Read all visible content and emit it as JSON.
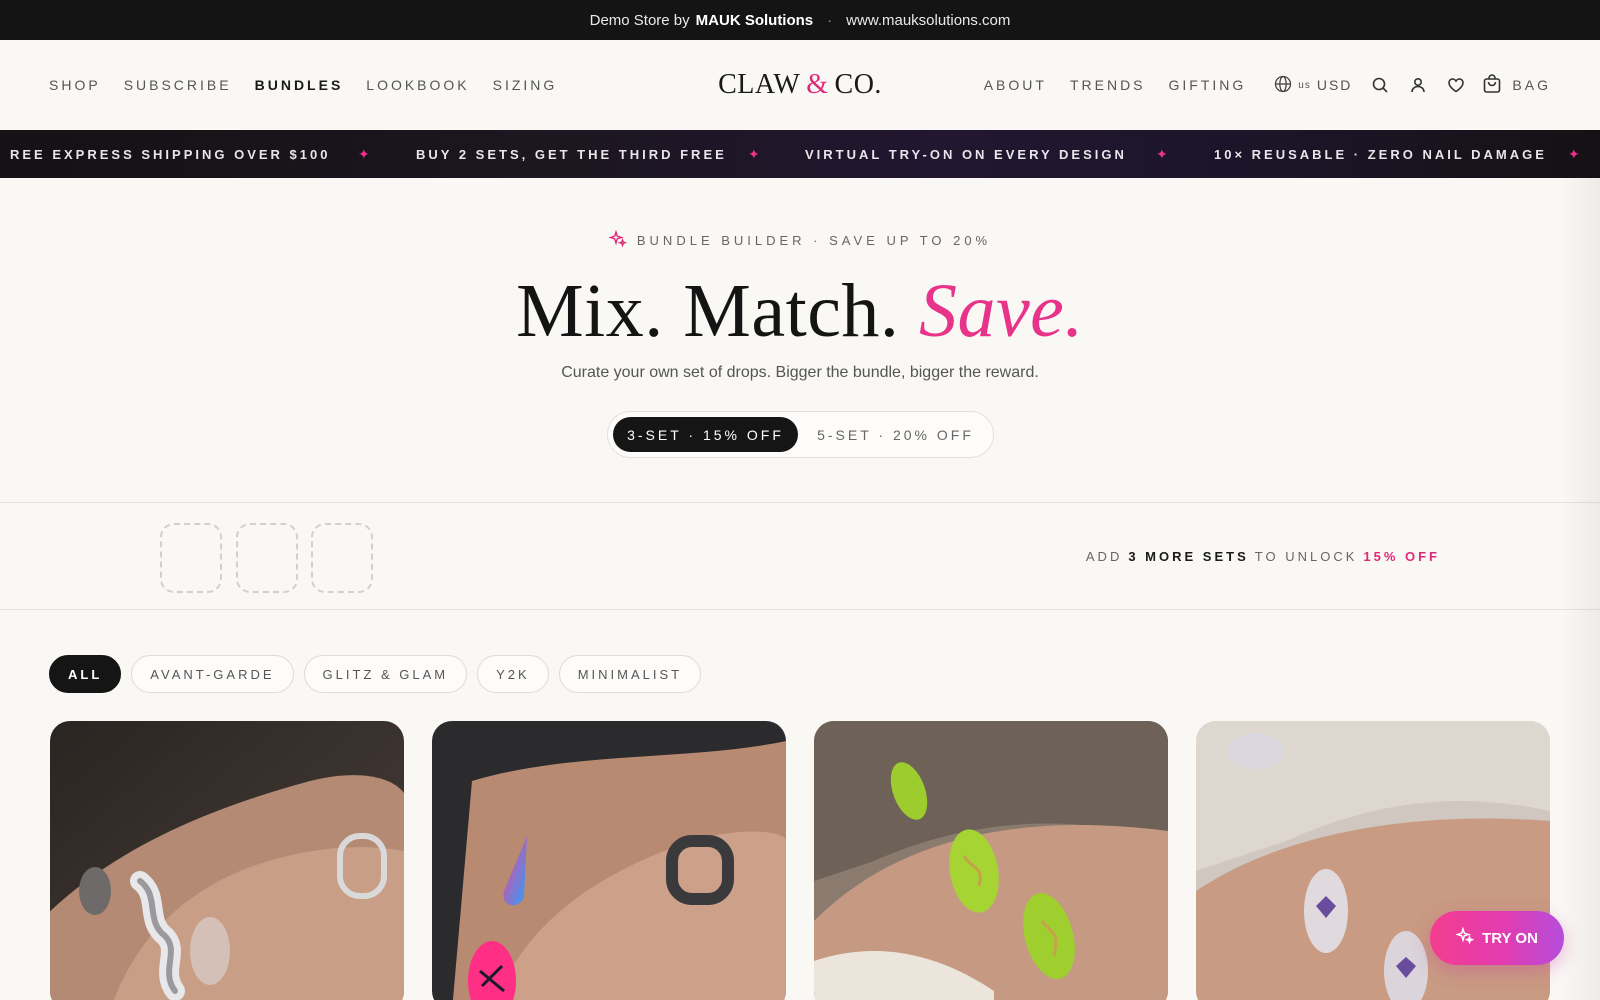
{
  "topbar": {
    "prefix": "Demo Store by",
    "brand": "MAUK Solutions",
    "separator": "·",
    "url": "www.mauksolutions.com"
  },
  "header": {
    "nav_left": [
      "SHOP",
      "SUBSCRIBE",
      "BUNDLES",
      "LOOKBOOK",
      "SIZING"
    ],
    "active_nav": "BUNDLES",
    "logo_left": "CLAW",
    "logo_amp": "&",
    "logo_right": "CO.",
    "nav_right": [
      "ABOUT",
      "TRENDS",
      "GIFTING"
    ],
    "region": "us",
    "currency": "USD",
    "bag_label": "BAG",
    "icons": [
      "globe-icon",
      "search-icon",
      "account-icon",
      "wishlist-heart-icon",
      "bag-icon"
    ]
  },
  "marquee": {
    "items": [
      "REE EXPRESS SHIPPING OVER $100",
      "BUY 2 SETS, GET THE THIRD FREE",
      "VIRTUAL TRY-ON ON EVERY DESIGN",
      "10× REUSABLE · ZERO NAIL DAMAGE"
    ],
    "separator_icon": "sparkle-star-icon"
  },
  "hero": {
    "eyebrow": "BUNDLE BUILDER · SAVE UP TO 20%",
    "title_main": "Mix. Match.",
    "title_accent": "Save.",
    "subtitle": "Curate your own set of drops. Bigger the bundle, bigger the reward.",
    "toggle_options": [
      "3-SET · 15% OFF",
      "5-SET · 20% OFF"
    ],
    "toggle_selected": "3-SET · 15% OFF"
  },
  "bundle_bar": {
    "empty_slots": 3,
    "msg_prefix": "ADD",
    "msg_count": "3 MORE SETS",
    "msg_middle": "TO UNLOCK",
    "msg_reward": "15% OFF"
  },
  "filters": {
    "chips": [
      "ALL",
      "AVANT-GARDE",
      "GLITZ & GLAM",
      "Y2K",
      "MINIMALIST"
    ],
    "active": "ALL"
  },
  "products": [
    {
      "image": "chrome-silver-wave-nails"
    },
    {
      "image": "pink-blue-gradient-nails"
    },
    {
      "image": "lime-green-gold-nails"
    },
    {
      "image": "clear-purple-crystal-nails"
    }
  ],
  "tryon": {
    "label": "TRY ON"
  },
  "colors": {
    "accent_pink": "#e8338a",
    "dark": "#141414",
    "background": "#faf8f5"
  }
}
